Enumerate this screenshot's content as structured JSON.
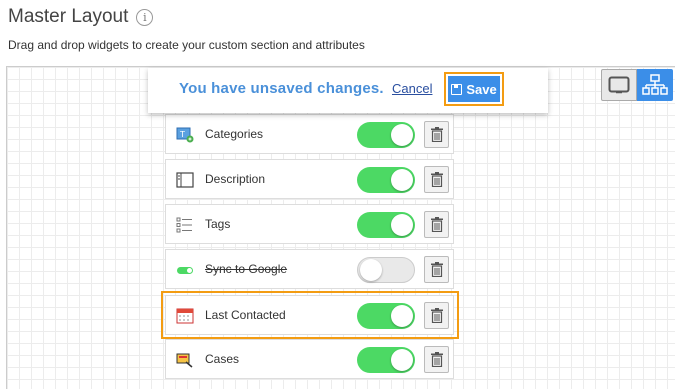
{
  "header": {
    "title": "Master Layout",
    "info_glyph": "i",
    "subtitle": "Drag and drop widgets to create your custom section and attributes"
  },
  "unsaved_bar": {
    "message": "You have unsaved changes.",
    "cancel_label": "Cancel",
    "save_label": "Save"
  },
  "view_toggle": {
    "options": [
      "desktop-icon",
      "org-tree-icon"
    ],
    "selected": "org-tree-icon"
  },
  "colors": {
    "accent": "#3b8ee8",
    "highlight": "#f39c12",
    "toggle_on": "#4cd964",
    "unsaved_text": "#4a90d9"
  },
  "widgets": [
    {
      "label": "Categories",
      "icon": "categories-icon",
      "enabled": true,
      "strikethrough": false
    },
    {
      "label": "Description",
      "icon": "description-icon",
      "enabled": true,
      "strikethrough": false
    },
    {
      "label": "Tags",
      "icon": "tags-icon",
      "enabled": true,
      "strikethrough": false
    },
    {
      "label": "Sync to Google",
      "icon": "sync-toggle-icon",
      "enabled": false,
      "strikethrough": true
    },
    {
      "label": "Last Contacted",
      "icon": "calendar-icon",
      "enabled": true,
      "strikethrough": false,
      "highlighted": true
    },
    {
      "label": "Cases",
      "icon": "cases-icon",
      "enabled": true,
      "strikethrough": false
    }
  ]
}
